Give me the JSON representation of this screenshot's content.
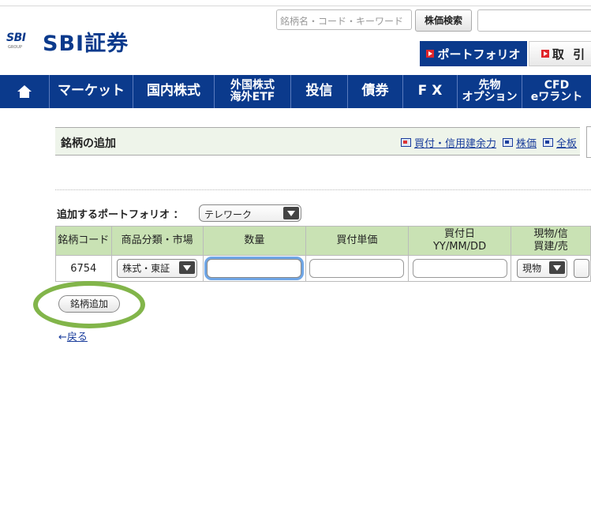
{
  "header": {
    "logo_mark": "SBI",
    "logo_group": "GROUP",
    "logo_text": "SBI証券",
    "search_placeholder": "銘柄名・コード・キーワード",
    "search_button": "株価検索",
    "portfolio_button": "ポートフォリオ",
    "trade_button": "取 引"
  },
  "nav": {
    "items": [
      {
        "label": "マーケット"
      },
      {
        "label": "国内株式"
      },
      {
        "line1": "外国株式",
        "line2": "海外ETF"
      },
      {
        "label": "投信"
      },
      {
        "label": "債券"
      },
      {
        "label": "F X"
      },
      {
        "line1": "先物",
        "line2": "オプション"
      },
      {
        "line1": "CFD",
        "line2": "eワラント"
      }
    ]
  },
  "section": {
    "title": "銘柄の追加",
    "links": [
      "買付・信用建余力",
      "株価",
      "全板"
    ]
  },
  "form": {
    "portfolio_label": "追加するポートフォリオ ：",
    "portfolio_value": "テレワーク",
    "columns": [
      "銘柄コード",
      "商品分類・市場",
      "数量",
      "買付単価",
      "買付日",
      "YY/MM/DD",
      "現物/信",
      "買建/売"
    ],
    "row": {
      "code": "6754",
      "market": "株式・東証",
      "quantity": "",
      "unit_price": "",
      "purchase_date": "",
      "type": "現物"
    },
    "add_button": "銘柄追加",
    "back_arrow": "←",
    "back_link": "戻る"
  },
  "colors": {
    "brand_blue": "#0b3a8c",
    "header_green": "#c9e2b4",
    "highlight_green": "#82b54a",
    "focus_blue": "#6fa6e6"
  }
}
